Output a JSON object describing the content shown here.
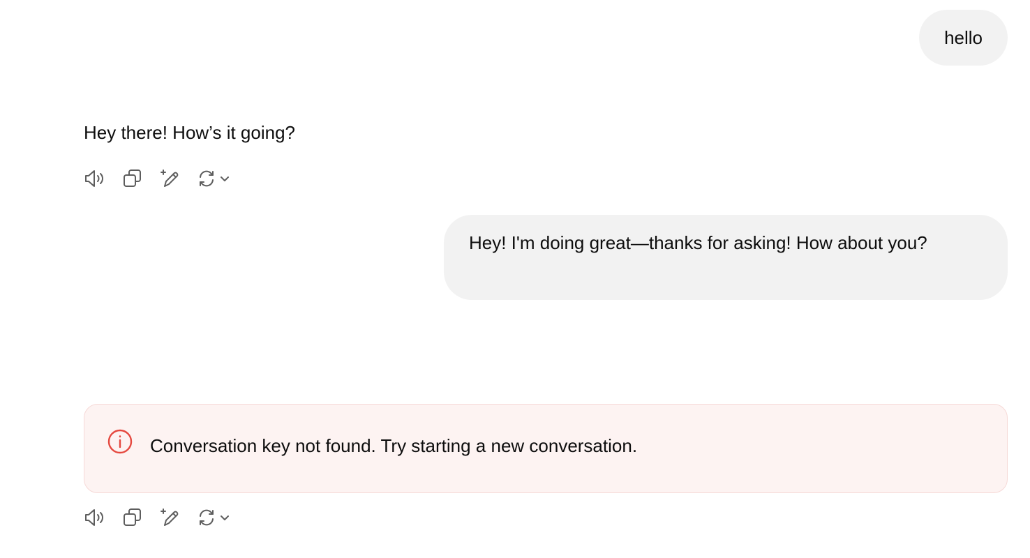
{
  "messages": {
    "user_1": "hello",
    "assistant_1": "Hey there! How’s it going?",
    "user_2": "Hey! I'm doing great—thanks for asking! How about you?"
  },
  "error": {
    "text": "Conversation key not found. Try starting a new conversation.",
    "icon": "info-circle-icon",
    "color": "#e5483f",
    "background": "#fdf3f2"
  },
  "actions": {
    "icons": [
      "speaker-icon",
      "copy-icon",
      "edit-sparkle-icon",
      "regenerate-icon",
      "chevron-down-icon"
    ]
  },
  "colors": {
    "user_bubble": "#f2f2f2",
    "icon": "#5d5d5d"
  }
}
